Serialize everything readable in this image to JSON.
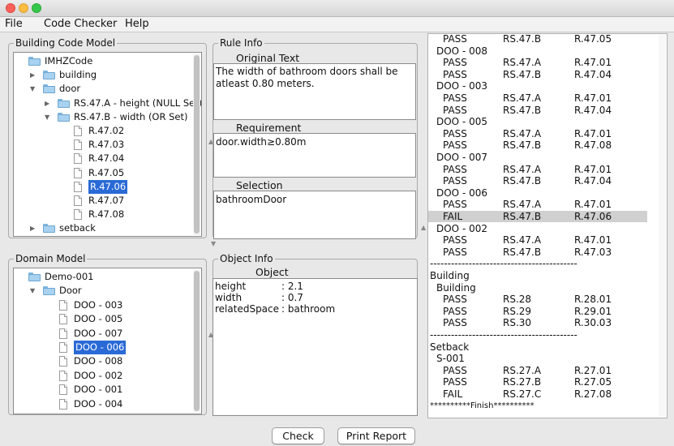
{
  "menu": [
    "File",
    "Code Checker",
    "Help"
  ],
  "building_code_model": {
    "title": "Building Code Model",
    "tree": [
      {
        "label": "IMHZCode",
        "kind": "folder",
        "indent": 0,
        "arrow": ""
      },
      {
        "label": "building",
        "kind": "folder",
        "indent": 1,
        "arrow": "▶"
      },
      {
        "label": "door",
        "kind": "folder",
        "indent": 1,
        "arrow": "▼"
      },
      {
        "label": "RS.47.A - height (NULL Set)",
        "kind": "folder",
        "indent": 2,
        "arrow": "▶"
      },
      {
        "label": "RS.47.B - width (OR Set)",
        "kind": "folder",
        "indent": 2,
        "arrow": "▼"
      },
      {
        "label": "R.47.02",
        "kind": "doc",
        "indent": 3,
        "arrow": ""
      },
      {
        "label": "R.47.03",
        "kind": "doc",
        "indent": 3,
        "arrow": ""
      },
      {
        "label": "R.47.04",
        "kind": "doc",
        "indent": 3,
        "arrow": ""
      },
      {
        "label": "R.47.05",
        "kind": "doc",
        "indent": 3,
        "arrow": ""
      },
      {
        "label": "R.47.06",
        "kind": "doc",
        "indent": 3,
        "arrow": "",
        "selected": true
      },
      {
        "label": "R.47.07",
        "kind": "doc",
        "indent": 3,
        "arrow": ""
      },
      {
        "label": "R.47.08",
        "kind": "doc",
        "indent": 3,
        "arrow": ""
      },
      {
        "label": "setback",
        "kind": "folder",
        "indent": 1,
        "arrow": "▶"
      }
    ]
  },
  "rule_info": {
    "title": "Rule Info",
    "original_text_label": "Original Text",
    "original_text": "The width of bathroom doors shall be atleast 0.80 meters.",
    "requirement_label": "Requirement",
    "requirement": "door.width≥0.80m",
    "selection_label": "Selection",
    "selection": "bathroomDoor"
  },
  "domain_model": {
    "title": "Domain Model",
    "tree": [
      {
        "label": "Demo-001",
        "kind": "folder",
        "indent": 0,
        "arrow": ""
      },
      {
        "label": "Door",
        "kind": "folder",
        "indent": 1,
        "arrow": "▼"
      },
      {
        "label": "DOO - 003",
        "kind": "doc",
        "indent": 2,
        "arrow": ""
      },
      {
        "label": "DOO - 005",
        "kind": "doc",
        "indent": 2,
        "arrow": ""
      },
      {
        "label": "DOO - 007",
        "kind": "doc",
        "indent": 2,
        "arrow": ""
      },
      {
        "label": "DOO - 006",
        "kind": "doc",
        "indent": 2,
        "arrow": "",
        "selected": true
      },
      {
        "label": "DOO - 008",
        "kind": "doc",
        "indent": 2,
        "arrow": ""
      },
      {
        "label": "DOO - 002",
        "kind": "doc",
        "indent": 2,
        "arrow": ""
      },
      {
        "label": "DOO - 001",
        "kind": "doc",
        "indent": 2,
        "arrow": ""
      },
      {
        "label": "DOO - 004",
        "kind": "doc",
        "indent": 2,
        "arrow": ""
      }
    ]
  },
  "object_info": {
    "title": "Object Info",
    "object_label": "Object",
    "props": [
      {
        "key": "height",
        "value": ": 2.1"
      },
      {
        "key": "width",
        "value": ": 0.7"
      },
      {
        "key": "relatedSpace",
        "value": ": bathroom"
      }
    ]
  },
  "report": [
    {
      "c1": "PASS",
      "c2": "RS.47.B",
      "c3": "R.47.05",
      "indent": 1
    },
    {
      "c1": "DOO - 008",
      "indent": 0
    },
    {
      "c1": "PASS",
      "c2": "RS.47.A",
      "c3": "R.47.01",
      "indent": 1
    },
    {
      "c1": "PASS",
      "c2": "RS.47.B",
      "c3": "R.47.04",
      "indent": 1
    },
    {
      "c1": "DOO - 003",
      "indent": 0
    },
    {
      "c1": "PASS",
      "c2": "RS.47.A",
      "c3": "R.47.01",
      "indent": 1
    },
    {
      "c1": "PASS",
      "c2": "RS.47.B",
      "c3": "R.47.04",
      "indent": 1
    },
    {
      "c1": "DOO - 005",
      "indent": 0
    },
    {
      "c1": "PASS",
      "c2": "RS.47.A",
      "c3": "R.47.01",
      "indent": 1
    },
    {
      "c1": "PASS",
      "c2": "RS.47.B",
      "c3": "R.47.08",
      "indent": 1
    },
    {
      "c1": "DOO - 007",
      "indent": 0
    },
    {
      "c1": "PASS",
      "c2": "RS.47.A",
      "c3": "R.47.01",
      "indent": 1
    },
    {
      "c1": "PASS",
      "c2": "RS.47.B",
      "c3": "R.47.04",
      "indent": 1
    },
    {
      "c1": "DOO - 006",
      "indent": 0
    },
    {
      "c1": "PASS",
      "c2": "RS.47.A",
      "c3": "R.47.01",
      "indent": 1
    },
    {
      "c1": "FAIL",
      "c2": "RS.47.B",
      "c3": "R.47.06",
      "indent": 1,
      "highlight": true
    },
    {
      "c1": "DOO - 002",
      "indent": 0
    },
    {
      "c1": "PASS",
      "c2": "RS.47.A",
      "c3": "R.47.01",
      "indent": 1
    },
    {
      "c1": "PASS",
      "c2": "RS.47.B",
      "c3": "R.47.03",
      "indent": 1
    },
    {
      "c1": "------------------------------------------",
      "indent": -1
    },
    {
      "c1": "Building",
      "indent": -1
    },
    {
      "c1": "Building",
      "indent": 0
    },
    {
      "c1": "PASS",
      "c2": "RS.28",
      "c3": "R.28.01",
      "indent": 1
    },
    {
      "c1": "PASS",
      "c2": "RS.29",
      "c3": "R.29.01",
      "indent": 1
    },
    {
      "c1": "PASS",
      "c2": "RS.30",
      "c3": "R.30.03",
      "indent": 1
    },
    {
      "c1": "------------------------------------------",
      "indent": -1
    },
    {
      "c1": "Setback",
      "indent": -1
    },
    {
      "c1": "S-001",
      "indent": 0
    },
    {
      "c1": "PASS",
      "c2": "RS.27.A",
      "c3": "R.27.01",
      "indent": 1
    },
    {
      "c1": "PASS",
      "c2": "RS.27.B",
      "c3": "R.27.05",
      "indent": 1
    },
    {
      "c1": "FAIL",
      "c2": "RS.27.C",
      "c3": "R.27.08",
      "indent": 1
    },
    {
      "c1": "**********Finish**********",
      "indent": -1
    }
  ],
  "buttons": {
    "check": "Check",
    "print_report": "Print Report"
  }
}
